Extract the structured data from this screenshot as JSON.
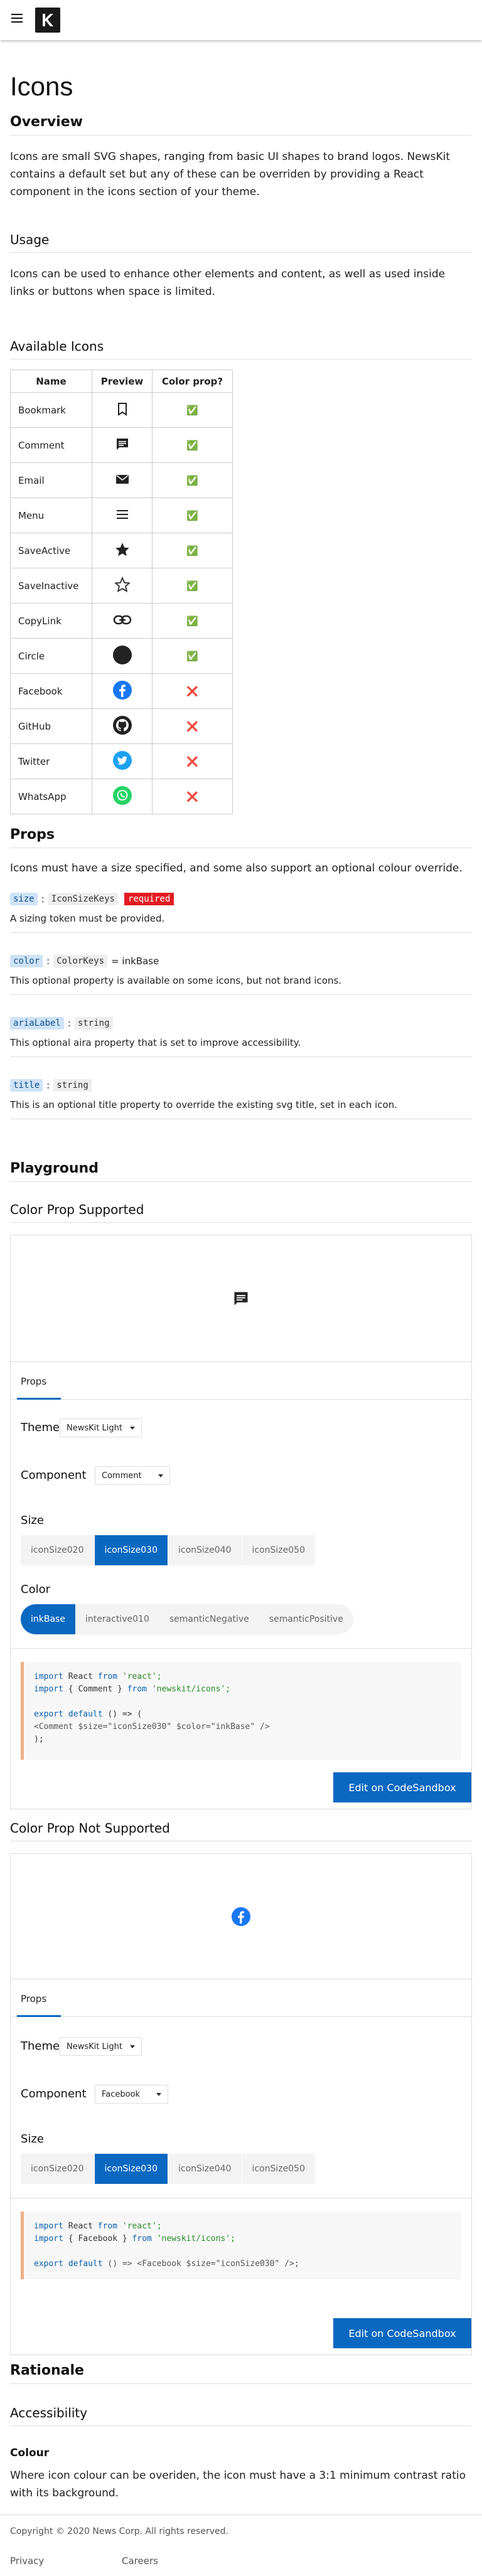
{
  "header": {
    "logo_letter": "K"
  },
  "page": {
    "title": "Icons"
  },
  "overview": {
    "heading": "Overview",
    "text": "Icons are small SVG shapes, ranging from basic UI shapes to brand logos. NewsKit contains a default set but any of these can be overriden by providing a React component in the icons section of your theme."
  },
  "usage": {
    "heading": "Usage",
    "text": "Icons can be used to enhance other elements and content, as well as used inside links or buttons when space is limited."
  },
  "available": {
    "heading": "Available Icons",
    "columns": [
      "Name",
      "Preview",
      "Color prop?"
    ],
    "rows": [
      {
        "name": "Bookmark",
        "icon": "bookmark-icon",
        "color": "✅"
      },
      {
        "name": "Comment",
        "icon": "comment-icon",
        "color": "✅"
      },
      {
        "name": "Email",
        "icon": "email-icon",
        "color": "✅"
      },
      {
        "name": "Menu",
        "icon": "menu-icon",
        "color": "✅"
      },
      {
        "name": "SaveActive",
        "icon": "star-filled-icon",
        "color": "✅"
      },
      {
        "name": "SaveInactive",
        "icon": "star-outline-icon",
        "color": "✅"
      },
      {
        "name": "CopyLink",
        "icon": "link-icon",
        "color": "✅"
      },
      {
        "name": "Circle",
        "icon": "circle-icon",
        "color": "✅"
      },
      {
        "name": "Facebook",
        "icon": "facebook-icon",
        "color": "❌"
      },
      {
        "name": "GitHub",
        "icon": "github-icon",
        "color": "❌"
      },
      {
        "name": "Twitter",
        "icon": "twitter-icon",
        "color": "❌"
      },
      {
        "name": "WhatsApp",
        "icon": "whatsapp-icon",
        "color": "❌"
      }
    ]
  },
  "props": {
    "heading": "Props",
    "intro": "Icons must have a size specified, and some also support an optional colour override.",
    "items": [
      {
        "name": "size",
        "type": "IconSizeKeys",
        "required": "required",
        "default": "",
        "desc": "A sizing token must be provided."
      },
      {
        "name": "color",
        "type": "ColorKeys",
        "required": "",
        "default": "= inkBase",
        "desc": "This optional property is available on some icons, but not brand icons."
      },
      {
        "name": "ariaLabel",
        "type": "string",
        "required": "",
        "default": "",
        "desc": "This optional aira property that is set to improve accessibility."
      },
      {
        "name": "title",
        "type": "string",
        "required": "",
        "default": "",
        "desc": "This is an optional title property to override the existing svg title, set in each icon."
      }
    ]
  },
  "playground": {
    "heading": "Playground",
    "supported": {
      "heading": "Color Prop Supported",
      "tab": "Props",
      "theme_label": "Theme",
      "theme_value": "NewsKit Light",
      "component_label": "Component",
      "component_value": "Comment",
      "size_label": "Size",
      "sizes": [
        "iconSize020",
        "iconSize030",
        "iconSize040",
        "iconSize050"
      ],
      "color_label": "Color",
      "colors": [
        "inkBase",
        "interactive010",
        "semanticNegative",
        "semanticPositive"
      ],
      "code": {
        "l1a": "import",
        "l1b": " React ",
        "l1c": "from",
        "l1d": " 'react';",
        "l2a": "import",
        "l2b": " { Comment } ",
        "l2c": "from",
        "l2d": " 'newskit/icons';",
        "l3a": "export default",
        "l3b": " () => (",
        "l4": "  <Comment $size=\"iconSize030\" $color=\"inkBase\" />",
        "l5": ");"
      },
      "button": "Edit on CodeSandbox"
    },
    "not_supported": {
      "heading": "Color Prop Not Supported",
      "tab": "Props",
      "theme_label": "Theme",
      "theme_value": "NewsKit Light",
      "component_label": "Component",
      "component_value": "Facebook",
      "size_label": "Size",
      "sizes": [
        "iconSize020",
        "iconSize030",
        "iconSize040",
        "iconSize050"
      ],
      "code": {
        "l1a": "import",
        "l1b": " React ",
        "l1c": "from",
        "l1d": " 'react';",
        "l2a": "import",
        "l2b": " { Facebook } ",
        "l2c": "from",
        "l2d": " 'newskit/icons';",
        "l3a": "export default",
        "l3b": " () => <Facebook $size=\"iconSize030\" />;"
      },
      "button": "Edit on CodeSandbox"
    }
  },
  "rationale": {
    "heading": "Rationale",
    "accessibility": "Accessibility",
    "colour_heading": "Colour",
    "colour_text": "Where icon colour can be overiden, the icon must have a 3:1 minimum contrast ratio with its background."
  },
  "footer": {
    "copyright": "Copyright © 2020 News Corp. All rights reserved.",
    "links": [
      "Privacy",
      "Careers"
    ]
  },
  "colors": {
    "accent": "#0a68c1",
    "required": "#e31b23",
    "facebook": "#1877f2",
    "twitter": "#1da1f2",
    "whatsapp": "#25d366"
  }
}
